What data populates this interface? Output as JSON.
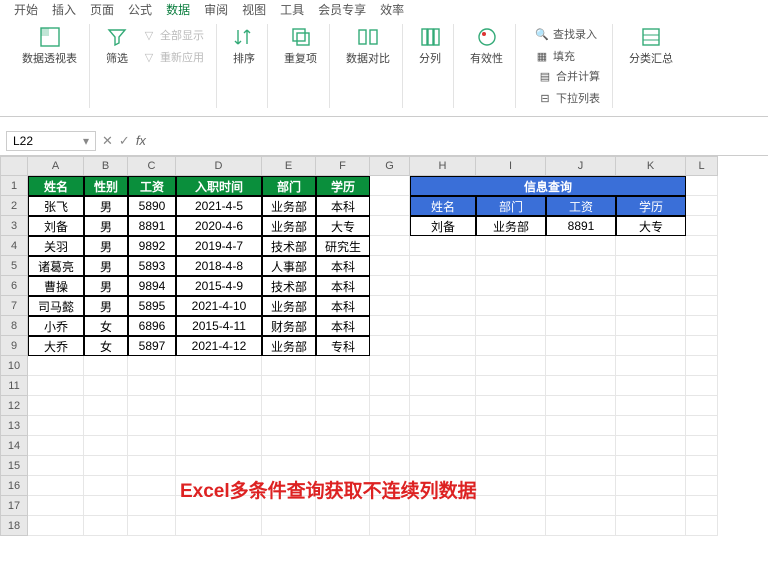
{
  "tabs": [
    "开始",
    "插入",
    "页面",
    "公式",
    "数据",
    "审阅",
    "视图",
    "工具",
    "会员专享",
    "效率"
  ],
  "toolbar": {
    "pivot": "数据透视表",
    "filter": "筛选",
    "showall": "全部显示",
    "reapply": "重新应用",
    "sort": "排序",
    "dup": "重复项",
    "compare": "数据对比",
    "split": "分列",
    "valid": "有效性",
    "find": "查找录入",
    "merge": "合并计算",
    "fill": "填充",
    "dropdown": "下拉列表",
    "subtotal": "分类汇总"
  },
  "namebox": "L22",
  "fx": "fx",
  "colLetters": [
    "A",
    "B",
    "C",
    "D",
    "E",
    "F",
    "G",
    "H",
    "I",
    "J",
    "K",
    "L"
  ],
  "rowNums": [
    "1",
    "2",
    "3",
    "4",
    "5",
    "6",
    "7",
    "8",
    "9",
    "10",
    "11",
    "12",
    "13",
    "14",
    "15",
    "16",
    "17",
    "18"
  ],
  "table1": {
    "headers": [
      "姓名",
      "性别",
      "工资",
      "入职时间",
      "部门",
      "学历"
    ],
    "rows": [
      [
        "张飞",
        "男",
        "5890",
        "2021-4-5",
        "业务部",
        "本科"
      ],
      [
        "刘备",
        "男",
        "8891",
        "2020-4-6",
        "业务部",
        "大专"
      ],
      [
        "关羽",
        "男",
        "9892",
        "2019-4-7",
        "技术部",
        "研究生"
      ],
      [
        "诸葛亮",
        "男",
        "5893",
        "2018-4-8",
        "人事部",
        "本科"
      ],
      [
        "曹操",
        "男",
        "9894",
        "2015-4-9",
        "技术部",
        "本科"
      ],
      [
        "司马懿",
        "男",
        "5895",
        "2021-4-10",
        "业务部",
        "本科"
      ],
      [
        "小乔",
        "女",
        "6896",
        "2015-4-11",
        "财务部",
        "本科"
      ],
      [
        "大乔",
        "女",
        "5897",
        "2021-4-12",
        "业务部",
        "专科"
      ]
    ]
  },
  "lookup": {
    "title": "信息查询",
    "headers": [
      "姓名",
      "部门",
      "工资",
      "学历"
    ],
    "row": [
      "刘备",
      "业务部",
      "8891",
      "大专"
    ]
  },
  "title_text": "Excel多条件查询获取不连续列数据"
}
